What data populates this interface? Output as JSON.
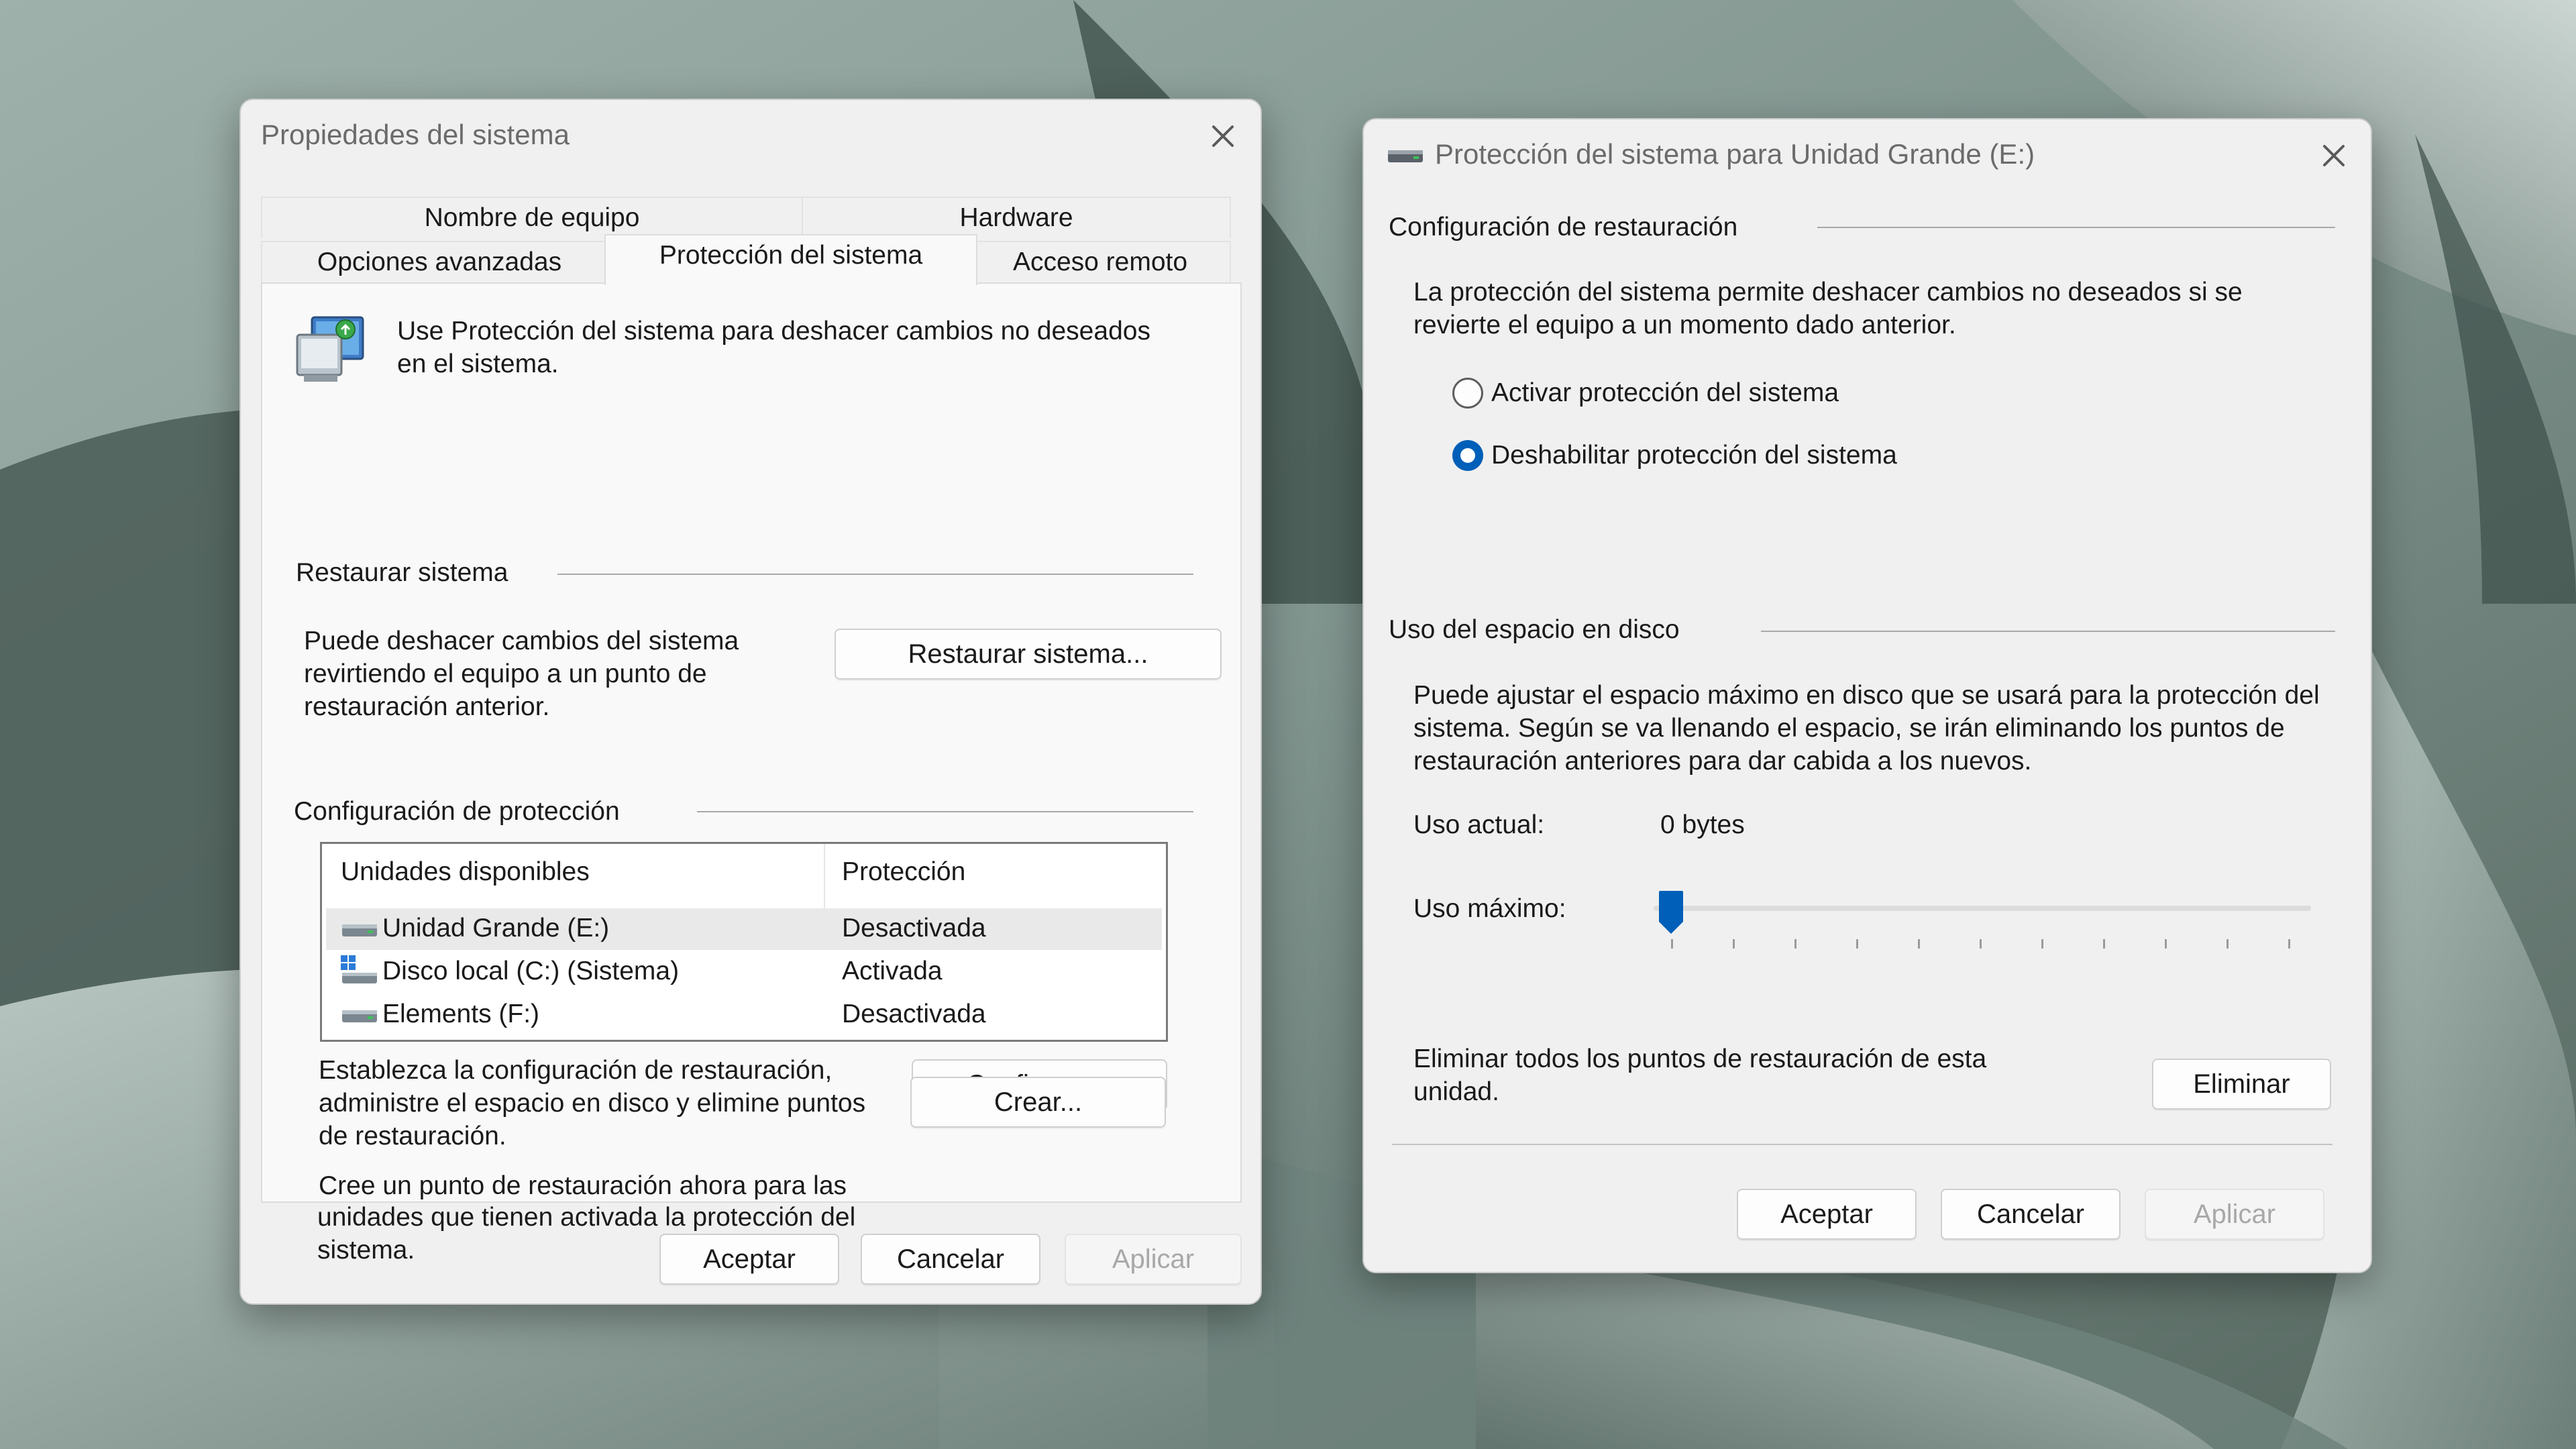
{
  "colors": {
    "accent": "#005fb8",
    "window_bg": "#f0f0f0",
    "panel_bg": "#f9f9f9"
  },
  "left_window": {
    "title": "Propiedades del sistema",
    "tabs_row1": [
      "Nombre de equipo",
      "Hardware"
    ],
    "tabs_row2": [
      "Opciones avanzadas",
      "Protección del sistema",
      "Acceso remoto"
    ],
    "active_tab": "Protección del sistema",
    "intro_icon": "system-protection-icon",
    "intro_line1": "Use Protección del sistema para deshacer cambios no deseados",
    "intro_line2": "en el sistema.",
    "restore": {
      "heading": "Restaurar sistema",
      "line1": "Puede deshacer cambios del sistema",
      "line2": "revirtiendo el equipo a un punto de",
      "line3": "restauración anterior.",
      "button": "Restaurar sistema..."
    },
    "protection": {
      "heading": "Configuración de protección",
      "columns": [
        "Unidades disponibles",
        "Protección"
      ],
      "drives": [
        {
          "name": "Unidad Grande (E:)",
          "status": "Desactivada",
          "icon": "drive-icon"
        },
        {
          "name": "Disco local (C:) (Sistema)",
          "status": "Activada",
          "icon": "windows-drive-icon"
        },
        {
          "name": "Elements (F:)",
          "status": "Desactivada",
          "icon": "drive-icon"
        }
      ],
      "configure_line1": "Establezca la configuración de restauración,",
      "configure_line2": "administre el espacio en disco y elimine puntos",
      "configure_line3": "de restauración.",
      "configure_button": "Configurar...",
      "create_line1": "Cree un punto de restauración ahora para las",
      "create_line2": "unidades que tienen activada la protección del",
      "create_line3": "sistema.",
      "create_button": "Crear..."
    },
    "buttons": {
      "ok": "Aceptar",
      "cancel": "Cancelar",
      "apply": "Aplicar"
    }
  },
  "right_window": {
    "title": "Protección del sistema para Unidad Grande (E:)",
    "restore_settings": {
      "heading": "Configuración de restauración",
      "line1": "La protección del sistema permite deshacer cambios no deseados si se",
      "line2": "revierte el equipo a un momento dado anterior.",
      "option_enable": "Activar protección del sistema",
      "option_disable": "Deshabilitar protección del sistema",
      "selected": "Deshabilitar protección del sistema"
    },
    "disk_usage": {
      "heading": "Uso del espacio en disco",
      "line1": "Puede ajustar el espacio máximo en disco que se usará para la protección del",
      "line2": "sistema. Según se va llenando el espacio, se irán eliminando los puntos de",
      "line3": "restauración anteriores para dar cabida a los nuevos.",
      "current_label": "Uso actual:",
      "current_value": "0 bytes",
      "max_label": "Uso máximo:",
      "max_slider_fraction": 0
    },
    "delete": {
      "line1": "Eliminar todos los puntos de restauración de esta",
      "line2": "unidad.",
      "button": "Eliminar"
    },
    "buttons": {
      "ok": "Aceptar",
      "cancel": "Cancelar",
      "apply": "Aplicar"
    }
  }
}
